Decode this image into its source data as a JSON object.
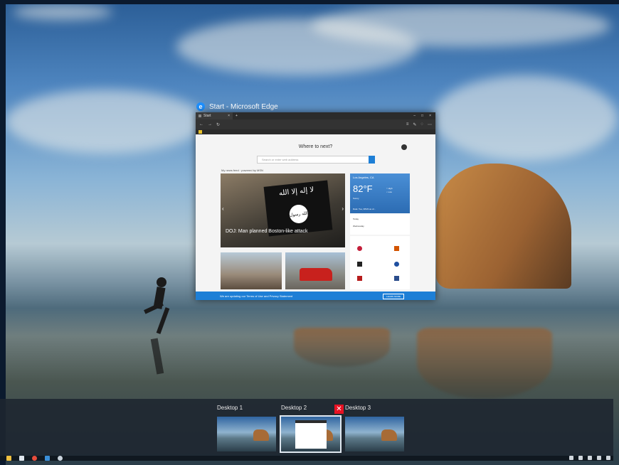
{
  "window": {
    "title": "Start - Microsoft Edge",
    "tab_title": "Start",
    "page_heading": "Where to next?",
    "search_placeholder": "Search or enter web address",
    "news_label": "My news feed · powered by MSN",
    "flag_text": "لا إله إلا الله",
    "flag_seal": "الله رسول",
    "hero_caption": "DOJ: Man planned Boston-like attack",
    "weather": {
      "city": "Los Angeles, CA",
      "temp": "82°F",
      "side": "↑ High\n↓ Low",
      "condition": "Sunny",
      "date": "Data: Tue, 08/23 as of..."
    },
    "forecast": [
      "Today",
      "Wednesday"
    ],
    "notice": "We are updating our Terms of Use and Privacy Statement",
    "learn_more": "LEARN MORE"
  },
  "desktops": [
    {
      "label": "Desktop 1",
      "active": false
    },
    {
      "label": "Desktop 2",
      "active": true
    },
    {
      "label": "Desktop 3",
      "active": false
    }
  ],
  "close_glyph": "✕",
  "taskbar": {
    "icons": [
      "file-explorer-icon",
      "store-icon",
      "chrome-icon",
      "app-icon",
      "settings-icon"
    ],
    "icon_colors": [
      "#f0c040",
      "#dfe6ee",
      "#e74c3c",
      "#3a8fd9",
      "#c9d3dc"
    ]
  }
}
